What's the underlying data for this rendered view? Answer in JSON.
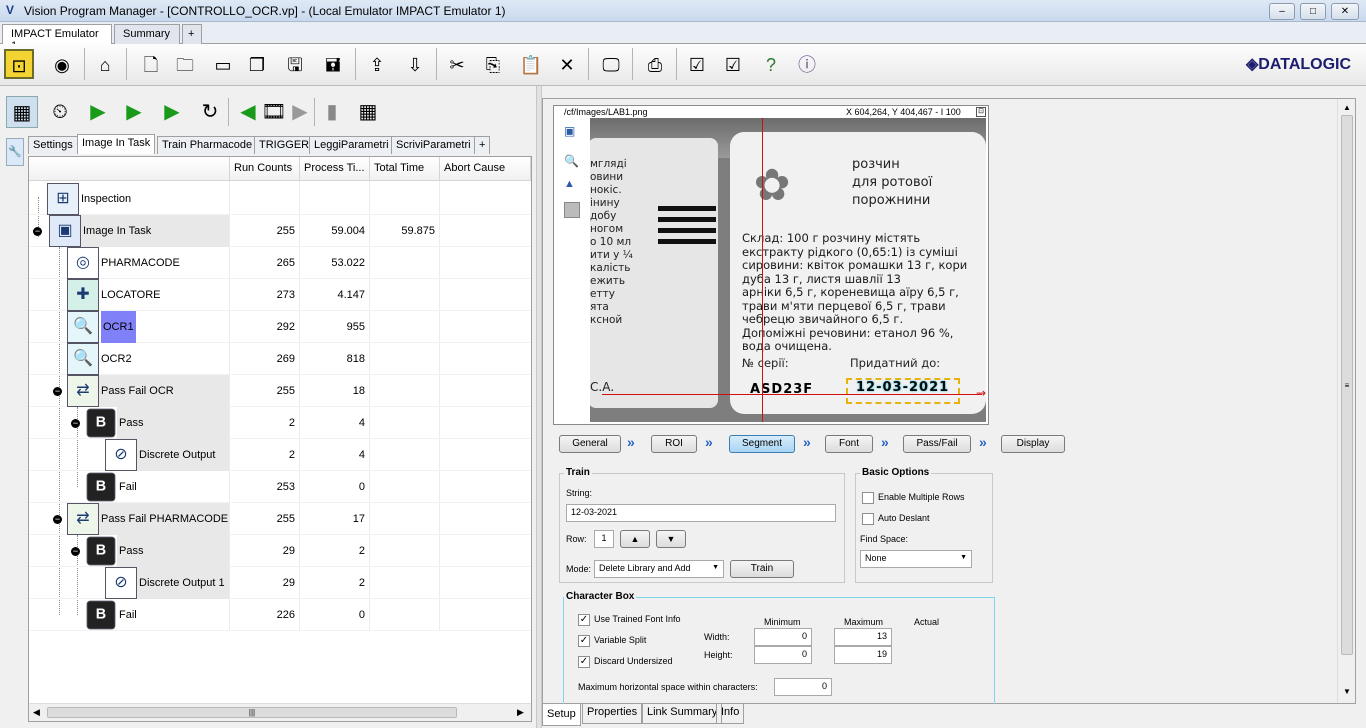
{
  "window": {
    "title": "Vision Program Manager - [CONTROLLO_OCR.vp] - (Local Emulator IMPACT Emulator 1)",
    "min": "–",
    "max": "□",
    "close": "✕"
  },
  "tabs": [
    {
      "label": "IMPACT Emulator 1"
    },
    {
      "label": "Summary"
    },
    {
      "label": "+"
    }
  ],
  "brand": {
    "logo": "◈DATALOGIC",
    "color": "#1d1d6e"
  },
  "task_tabs": [
    {
      "label": "Settings"
    },
    {
      "label": "Image In Task"
    },
    {
      "label": "Train Pharmacode"
    },
    {
      "label": "TRIGGER"
    },
    {
      "label": "LeggiParametri"
    },
    {
      "label": "ScriviParametri"
    },
    {
      "label": "+"
    }
  ],
  "table": {
    "headers": [
      "Run Counts",
      "Process Ti...",
      "Total Time",
      "Abort Cause"
    ],
    "rows": [
      {
        "name": "Inspection",
        "runs": "",
        "process": "",
        "total": ""
      },
      {
        "name": "Image In Task",
        "runs": "255",
        "process": "59.004",
        "total": "59.875"
      },
      {
        "name": "PHARMACODE",
        "runs": "265",
        "process": "53.022",
        "total": ""
      },
      {
        "name": "LOCATORE",
        "runs": "273",
        "process": "4.147",
        "total": ""
      },
      {
        "name": "OCR1",
        "runs": "292",
        "process": "955",
        "total": ""
      },
      {
        "name": "OCR2",
        "runs": "269",
        "process": "818",
        "total": ""
      },
      {
        "name": "Pass Fail OCR",
        "runs": "255",
        "process": "18",
        "total": ""
      },
      {
        "name": "Pass",
        "runs": "2",
        "process": "4",
        "total": ""
      },
      {
        "name": "Discrete Output",
        "runs": "2",
        "process": "4",
        "total": ""
      },
      {
        "name": "Fail",
        "runs": "253",
        "process": "0",
        "total": ""
      },
      {
        "name": "Pass Fail PHARMACODE",
        "runs": "255",
        "process": "17",
        "total": ""
      },
      {
        "name": "Pass",
        "runs": "29",
        "process": "2",
        "total": ""
      },
      {
        "name": "Discrete Output 1",
        "runs": "29",
        "process": "2",
        "total": ""
      },
      {
        "name": "Fail",
        "runs": "226",
        "process": "0",
        "total": ""
      }
    ]
  },
  "image_view": {
    "path": "/cf/Images/LAB1.png",
    "coords": "X 604,264, Y 404,467 - I 100",
    "left_text": [
      "мгляді",
      "овини",
      "нокіс.",
      "інину",
      "добу",
      "ногом",
      "о 10 мл",
      "ити у ¼",
      "калість",
      "ежить",
      "етту",
      "ята",
      "ксной"
    ],
    "heading": [
      "розчин",
      "для ротової",
      "порожнини"
    ],
    "body": [
      "Склад: 100 г розчину містять",
      "екстракту рідкого (0,65:1) із суміші",
      "сировини: квіток ромашки 13 г, кори",
      "дуба 13 г, листя шавлії 13",
      "арніки 6,5 г, кореневища аїру 6,5 г,",
      "трави м'яти перцевої 6,5 г, трави",
      "чебрецю звичайного 6,5 г.",
      "Допоміжні речовини: етанол 96 %,",
      "вода очищена."
    ],
    "serial_label": "№ серії:",
    "expiry_label": "Придатний до:",
    "ca": "С.А.",
    "lot": "ASD23F",
    "date": "12-03-2021"
  },
  "steps": [
    {
      "label": "General"
    },
    {
      "label": "ROI"
    },
    {
      "label": "Segment"
    },
    {
      "label": "Font"
    },
    {
      "label": "Pass/Fail"
    },
    {
      "label": "Display"
    }
  ],
  "train": {
    "title": "Train",
    "string_label": "String:",
    "string_value": "12-03-2021",
    "row_label": "Row:",
    "row_value": "1",
    "mode_label": "Mode:",
    "mode_value": "Delete Library and Add",
    "train_button": "Train"
  },
  "basic": {
    "title": "Basic Options",
    "multi_rows": "Enable Multiple Rows",
    "deslant": "Auto Deslant",
    "find_space_label": "Find Space:",
    "find_space_value": "None"
  },
  "charbox": {
    "title": "Character Box",
    "use_trained": "Use Trained Font Info",
    "variable_split": "Variable Split",
    "discard": "Discard Undersized",
    "min_label": "Minimum",
    "max_label": "Maximum",
    "actual_label": "Actual",
    "width_label": "Width:",
    "height_label": "Height:",
    "width_min": "0",
    "width_max": "13",
    "height_min": "0",
    "height_max": "19",
    "hspace_label": "Maximum horizontal space within characters:",
    "hspace_value": "0"
  },
  "bottom_tabs": [
    {
      "label": "Setup"
    },
    {
      "label": "Properties"
    },
    {
      "label": "Link Summary"
    },
    {
      "label": "Info"
    }
  ]
}
